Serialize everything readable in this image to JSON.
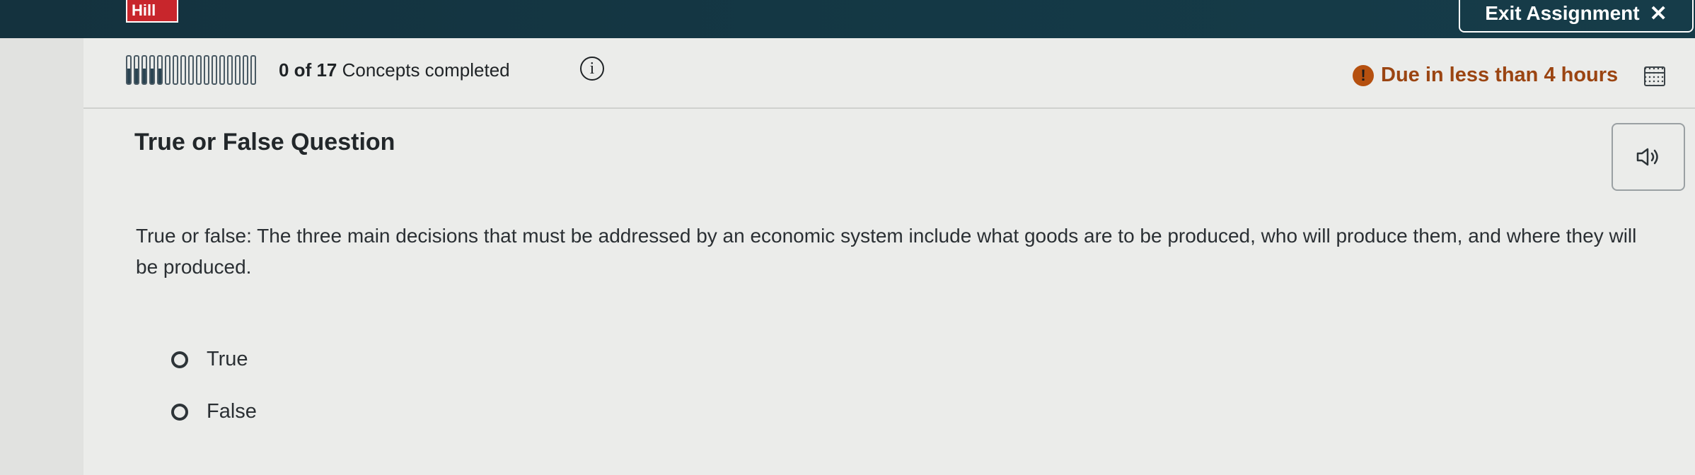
{
  "header": {
    "logo_text": "Hill",
    "exit_label": "Exit Assignment",
    "exit_icon": "close-icon"
  },
  "progress": {
    "completed": 0,
    "total": 17,
    "completed_text": "0 of 17",
    "suffix_text": "Concepts completed",
    "segment_count": 17,
    "segments_filled": 5
  },
  "due": {
    "text": "Due in less than 4 hours",
    "alert_color": "#b5500f"
  },
  "question": {
    "title": "True or False Question",
    "prompt": "True or false: The three main decisions that must be addressed by an economic system include what goods are to be produced, who will produce them, and where they will be produced.",
    "options": [
      {
        "label": "True",
        "selected": false
      },
      {
        "label": "False",
        "selected": false
      }
    ]
  },
  "colors": {
    "topbar": "#143845",
    "logo": "#c8262c",
    "due_text": "#9b4512"
  }
}
